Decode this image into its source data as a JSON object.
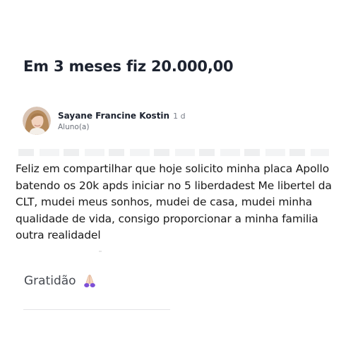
{
  "post": {
    "title": "Em 3 meses fiz 20.000,00",
    "author": {
      "name": "Sayane Francine Kostin",
      "age": "1 d",
      "role": "Aluno(a)"
    },
    "body": "Feliz em compartilhar que hoje solicito minha placa Apollo batendo os 20k apds iniciar no 5 liberdadest Me libertel da CLT, mudei meus sonhos, mudei de casa, mudei minha qualidade de vida, consigo proporcionar a minha familia outra realidadel",
    "gratitude": "Gratidão",
    "gratitude_icon": "praying-hands-icon"
  }
}
